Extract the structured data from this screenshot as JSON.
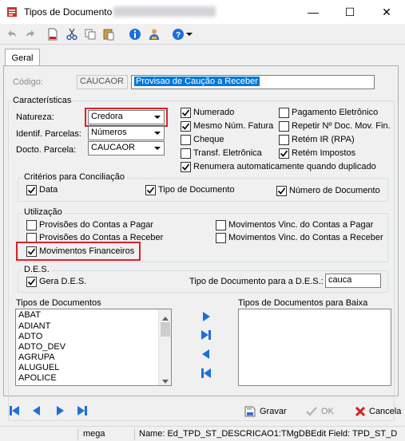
{
  "window": {
    "title": "Tipos de Documento",
    "minimize_glyph": "—",
    "maximize_glyph": "☐",
    "close_glyph": "✕"
  },
  "toolbar": {
    "icons": [
      "undo-icon",
      "redo-icon",
      "new-document-icon",
      "cut-icon",
      "copy-icon",
      "paste-icon",
      "info-icon",
      "users-icon",
      "help-icon",
      "dropdown-arrow-icon"
    ]
  },
  "tabs": [
    {
      "label": "Geral"
    }
  ],
  "codigo": {
    "label": "Código:",
    "code_value": "CAUCAOR",
    "description_value": "Provisao de Caução a Receber"
  },
  "caracteristicas": {
    "title": "Características",
    "natureza": {
      "label": "Natureza:",
      "value": "Credora"
    },
    "identif_parcelas": {
      "label": "Identif. Parcelas:",
      "value": "Números"
    },
    "docto_parcela": {
      "label": "Docto. Parcela:",
      "value": "CAUCAOR"
    },
    "checks_col1": [
      {
        "label": "Numerado",
        "checked": true
      },
      {
        "label": "Mesmo Núm. Fatura",
        "checked": true
      },
      {
        "label": "Cheque",
        "checked": false
      },
      {
        "label": "Transf. Eletrônica",
        "checked": false
      }
    ],
    "checks_col2": [
      {
        "label": "Pagamento Eletrônico",
        "checked": false
      },
      {
        "label": "Repetir Nº Doc. Mov. Fin.",
        "checked": false
      },
      {
        "label": "Retém IR (RPA)",
        "checked": false
      },
      {
        "label": "Retém Impostos",
        "checked": true
      }
    ],
    "renumera": {
      "label": "Renumera automaticamente quando duplicado",
      "checked": true
    }
  },
  "conciliacao": {
    "title": "Critérios para Conciliação",
    "items": [
      {
        "label": "Data",
        "checked": true
      },
      {
        "label": "Tipo de Documento",
        "checked": true
      },
      {
        "label": "Número de Documento",
        "checked": true
      }
    ]
  },
  "utilizacao": {
    "title": "Utilização",
    "items": [
      {
        "label": "Provisões do Contas a Pagar",
        "checked": false
      },
      {
        "label": "Provisões do Contas a Receber",
        "checked": false
      },
      {
        "label": "Movimentos Financeiros",
        "checked": true
      },
      {
        "label": "Movimentos Vinc. do Contas a Pagar",
        "checked": false
      },
      {
        "label": "Movimentos Vinc. do Contas a Receber",
        "checked": false
      }
    ]
  },
  "des": {
    "title": "D.E.S.",
    "gera": {
      "label": "Gera D.E.S.",
      "checked": true
    },
    "tipo_label": "Tipo de Documento para a D.E.S.:",
    "tipo_value": "cauca"
  },
  "tipos_documentos": {
    "title": "Tipos de Documentos",
    "items": [
      "ABAT",
      "ADIANT",
      "ADTO",
      "ADTO_DEV",
      "AGRUPA",
      "ALUGUEL",
      "APOLICE"
    ]
  },
  "tipos_baixa": {
    "title": "Tipos de Documentos para Baixa",
    "items": []
  },
  "transfer_buttons": [
    "move-right-icon",
    "move-all-right-icon",
    "move-left-icon",
    "move-all-left-icon"
  ],
  "nav_buttons": [
    "first-record-icon",
    "previous-record-icon",
    "next-record-icon",
    "last-record-icon"
  ],
  "actions": {
    "save": "Gravar",
    "ok": "OK",
    "cancel": "Cancela"
  },
  "status": {
    "user": "mega",
    "field_info": "Name: Ed_TPD_ST_DESCRICAO1:TMgDBEdit Field: TPD_ST_D"
  },
  "colors": {
    "selection": "#0078d7",
    "highlight_box": "#d9232b",
    "nav_blue": "#1e6fd9",
    "cancel_red": "#d0201f"
  }
}
